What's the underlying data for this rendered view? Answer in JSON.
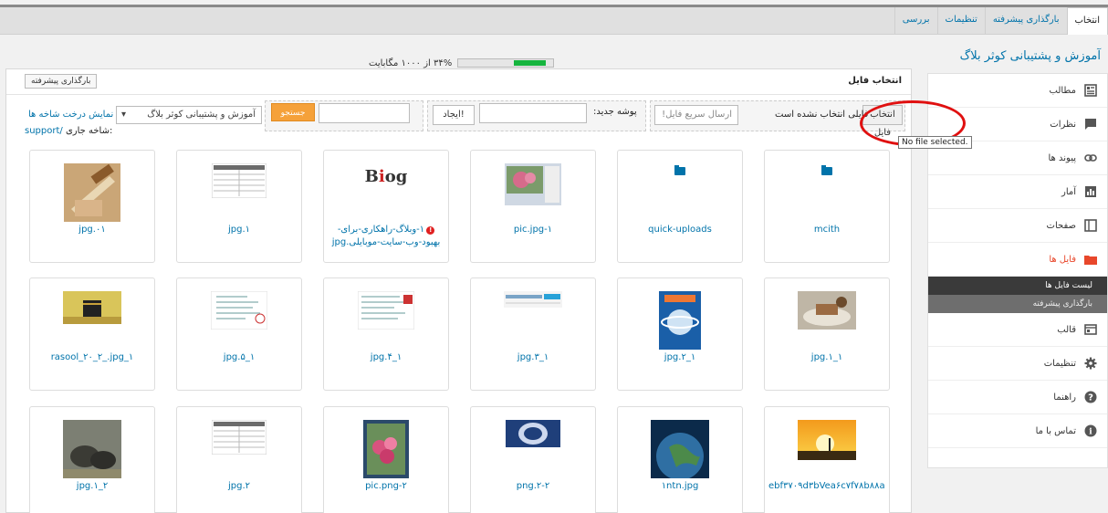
{
  "tabs": [
    "انتخاب",
    "بارگذاری پیشرفته",
    "تنظیمات",
    "بررسی"
  ],
  "site_title": "آموزش و پشتیبانی کوثر بلاگ",
  "sidebar": {
    "items": [
      {
        "label": "مطالب",
        "icon": "posts-icon"
      },
      {
        "label": "نظرات",
        "icon": "comments-icon"
      },
      {
        "label": "پیوند ها",
        "icon": "link-icon"
      },
      {
        "label": "آمار",
        "icon": "stats-icon"
      },
      {
        "label": "صفحات",
        "icon": "pages-icon"
      },
      {
        "label": "فایل ها",
        "icon": "folder-icon"
      }
    ],
    "submenu": [
      "لیست فایل ها",
      "بارگذاری پیشرفته"
    ],
    "items_after": [
      {
        "label": "قالب",
        "icon": "template-icon"
      },
      {
        "label": "تنظیمات",
        "icon": "gear-icon"
      },
      {
        "label": "راهنما",
        "icon": "help-icon"
      },
      {
        "label": "تماس با ما",
        "icon": "info-icon"
      }
    ]
  },
  "quota": {
    "text": "۳۴% از ۱۰۰۰ مگابایت",
    "percent": 34
  },
  "main": {
    "title": "انتخاب فایل",
    "advanced_upload_button": "بارگذاری پیشرفته"
  },
  "toolbar": {
    "choose_file_button": "انتخاب فایل",
    "no_file_text": "فایلی انتخاب نشده است",
    "quick_send_placeholder": "ارسال سریع فایل!",
    "new_folder_label": "پوشه جدید:",
    "create_button": "ایجاد!",
    "search_button": "جستجو",
    "folder_select": "آموزش و پشتیبانی کوثر بلاگ",
    "show_tree_link": "نمایش درخت شاخه ها",
    "current_path_label": "شاخه جاری:",
    "current_path": "support/"
  },
  "tooltip": "No file selected.",
  "files": [
    {
      "name": "mcith",
      "type": "folder"
    },
    {
      "name": "quick-uploads",
      "type": "folder"
    },
    {
      "name": "pic.jpg-۱",
      "type": "image",
      "thumb": "window"
    },
    {
      "name": "۱-وبلاگ-راهکاری-برای-بهبود-وب-سایت-موبایلی.jpg",
      "type": "image",
      "thumb": "blog",
      "error": true
    },
    {
      "name": "jpg.۱",
      "type": "image",
      "thumb": "table"
    },
    {
      "name": "jpg.۰۱",
      "type": "image",
      "thumb": "writing"
    },
    {
      "name": "jpg.۱_۱",
      "type": "image",
      "thumb": "food"
    },
    {
      "name": "jpg.۲_۱",
      "type": "image",
      "thumb": "magazine"
    },
    {
      "name": "jpg.۳_۱",
      "type": "image",
      "thumb": "web"
    },
    {
      "name": "jpg.۴_۱",
      "type": "image",
      "thumb": "doc"
    },
    {
      "name": "jpg.۵_۱",
      "type": "image",
      "thumb": "doc2"
    },
    {
      "name": "rasool_۲۰_۲_.jpg_۱",
      "type": "image",
      "thumb": "kaaba"
    },
    {
      "name": "ebf۳۷۰۹d۳bVea۶c۷f۷۸b۸۸a۴.jpg",
      "type": "image",
      "thumb": "sunset"
    },
    {
      "name": "۱ntn.jpg",
      "type": "image",
      "thumb": "earth"
    },
    {
      "name": "png.۲-۲",
      "type": "image",
      "thumb": "tile"
    },
    {
      "name": "pic.png-۲",
      "type": "image",
      "thumb": "flowers"
    },
    {
      "name": "jpg.۲",
      "type": "image",
      "thumb": "table"
    },
    {
      "name": "jpg.۱_۲",
      "type": "image",
      "thumb": "shoes"
    }
  ]
}
